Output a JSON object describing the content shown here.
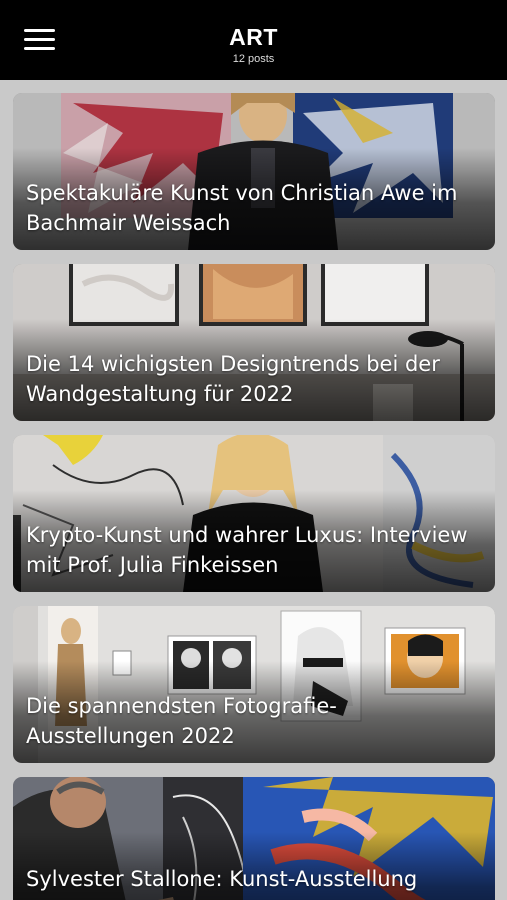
{
  "header": {
    "title": "ART",
    "subtitle": "12 posts",
    "menu_icon": "hamburger-menu-icon"
  },
  "posts": [
    {
      "title": "Spektakuläre Kunst von Christian Awe im Bachmair Weissach"
    },
    {
      "title": "Die 14 wichigsten Designtrends bei der Wandgestaltung für 2022"
    },
    {
      "title": "Krypto-Kunst und wahrer Luxus: Interview mit Prof. Julia Finkeissen"
    },
    {
      "title": "Die spannendsten Fotografie-Ausstellungen 2022"
    },
    {
      "title": "Sylvester Stallone: Kunst-Ausstellung"
    }
  ],
  "colors": {
    "topbar": "#000000",
    "background": "#c9c9c9",
    "text": "#ffffff"
  }
}
